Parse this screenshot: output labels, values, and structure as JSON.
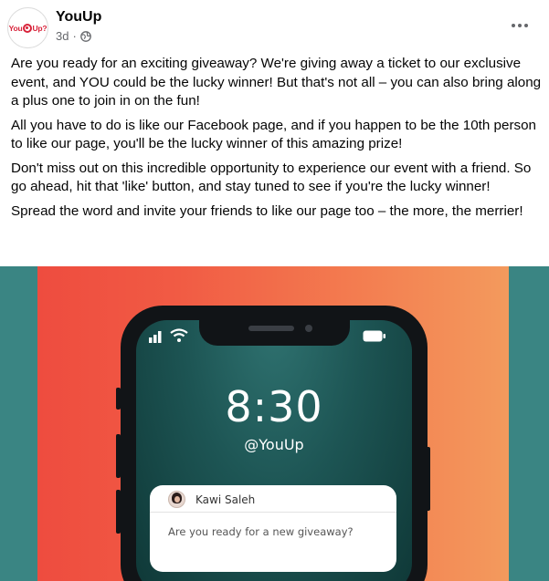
{
  "post": {
    "page_name": "YouUp",
    "time": "3d",
    "separator": "·",
    "privacy_icon": "globe-icon",
    "more_icon": "more-horizontal-icon",
    "logo": {
      "left": "You",
      "right": "Up",
      "suffix": "?"
    }
  },
  "body": {
    "paragraphs": [
      "Are you ready for an exciting giveaway? We're giving away a ticket to our exclusive event, and YOU could be the lucky winner! But that's not all – you can also bring along a plus one to join in on the fun!",
      "All you have to do is like our Facebook page, and if you happen to be the 10th person to like our page, you'll be the lucky winner of this amazing prize!",
      "Don't miss out on this incredible opportunity to experience our event with a friend. So go ahead, hit that 'like' button, and stay tuned to see if you're the lucky winner!",
      "Spread the word and invite your friends to like our page too – the more, the merrier!"
    ]
  },
  "image": {
    "clock": "8:30",
    "handle": "@YouUp",
    "notification": {
      "sender": "Kawi Saleh",
      "message": "Are you ready for a new giveaway?"
    },
    "status_icons": [
      "signal-icon",
      "wifi-icon",
      "battery-icon"
    ],
    "colors": {
      "teal": "#3a8583",
      "red": "#ee4c3f",
      "orange": "#f39a5d",
      "screen": "#1d5554"
    }
  }
}
